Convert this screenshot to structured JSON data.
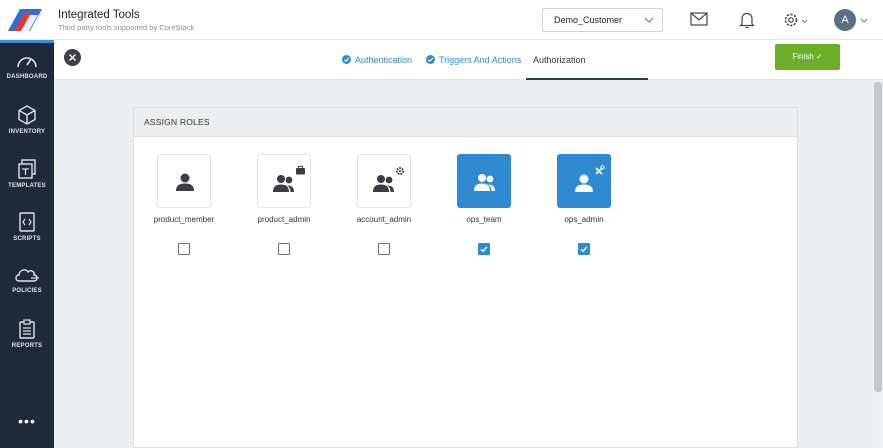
{
  "header": {
    "title": "Integrated Tools",
    "subtitle": "Third party tools supported by CoreStack",
    "customer_select": "Demo_Customer",
    "avatar_initial": "A"
  },
  "sidebar": {
    "items": [
      {
        "label": "DASHBOARD",
        "icon": "gauge-icon"
      },
      {
        "label": "INVENTORY",
        "icon": "cube-icon"
      },
      {
        "label": "TEMPLATES",
        "icon": "templates-icon"
      },
      {
        "label": "SCRIPTS",
        "icon": "script-icon"
      },
      {
        "label": "POLICIES",
        "icon": "cloud-icon"
      },
      {
        "label": "REPORTS",
        "icon": "clipboard-icon"
      }
    ],
    "more": "•••"
  },
  "wizard": {
    "steps": [
      {
        "label": "Authentication",
        "state": "done"
      },
      {
        "label": "Triggers And Actions",
        "state": "done"
      },
      {
        "label": "Authorization",
        "state": "active"
      }
    ],
    "finish_label": "Finish ✓"
  },
  "panel": {
    "title": "ASSIGN ROLES",
    "roles": [
      {
        "name": "product_member",
        "checked": false,
        "icon": "user-icon"
      },
      {
        "name": "product_admin",
        "checked": false,
        "icon": "users-briefcase-icon"
      },
      {
        "name": "account_admin",
        "checked": false,
        "icon": "users-gear-icon"
      },
      {
        "name": "ops_team",
        "checked": true,
        "icon": "users-icon"
      },
      {
        "name": "ops_admin",
        "checked": true,
        "icon": "user-tools-icon"
      }
    ]
  },
  "colors": {
    "accent": "#2f8ad1",
    "finish": "#6cae2a",
    "sidebar": "#1f2a3a"
  }
}
